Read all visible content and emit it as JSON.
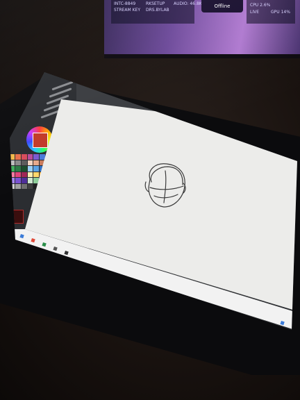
{
  "scene": {
    "background_monitor": {
      "badge_label": "Offline",
      "texts": [
        "INTC-8849",
        "STREAM KEY",
        "RKSETUP",
        "DRS.BYLAB",
        "AUDIO: 46.8K",
        "CPU 2.6%",
        "LIVE",
        "GPU 14%"
      ]
    },
    "tablet": {
      "app": "drawing application",
      "sketch": "rough pencil head sketch",
      "colors": {
        "canvas": "#ececea",
        "ui_dark": "#2e3033",
        "primary_color": "#c23a28"
      }
    }
  }
}
